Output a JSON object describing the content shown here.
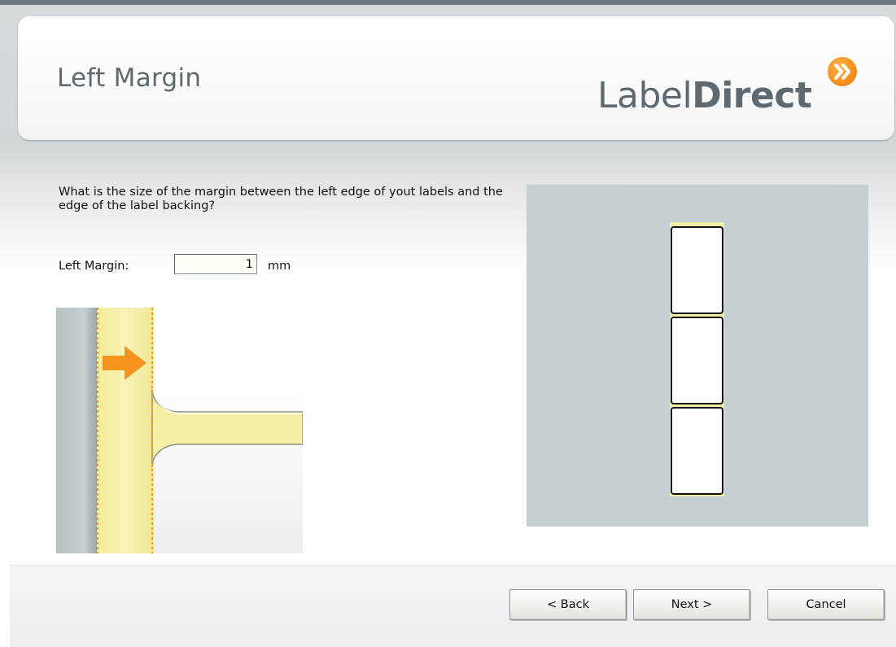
{
  "header": {
    "title": "Left Margin",
    "logo": {
      "text_regular": "Label",
      "text_bold": "Direct"
    }
  },
  "content": {
    "question": "What is the size of the margin between the left edge of yout labels and the edge of the label backing?",
    "field_label": "Left Margin:",
    "field_value": "1",
    "unit": "mm"
  },
  "preview": {
    "label_count": 3
  },
  "buttons": {
    "back": "< Back",
    "next": "Next >",
    "cancel": "Cancel"
  },
  "colors": {
    "title_gray": "#5f6a70",
    "accent_orange": "#f7941d",
    "label_yellow": "#f6f0a6",
    "preview_bg": "#c4cfd2"
  },
  "icons": {
    "logo_badge": "double-chevron-right-icon",
    "illustration_arrow": "arrow-right-icon"
  }
}
